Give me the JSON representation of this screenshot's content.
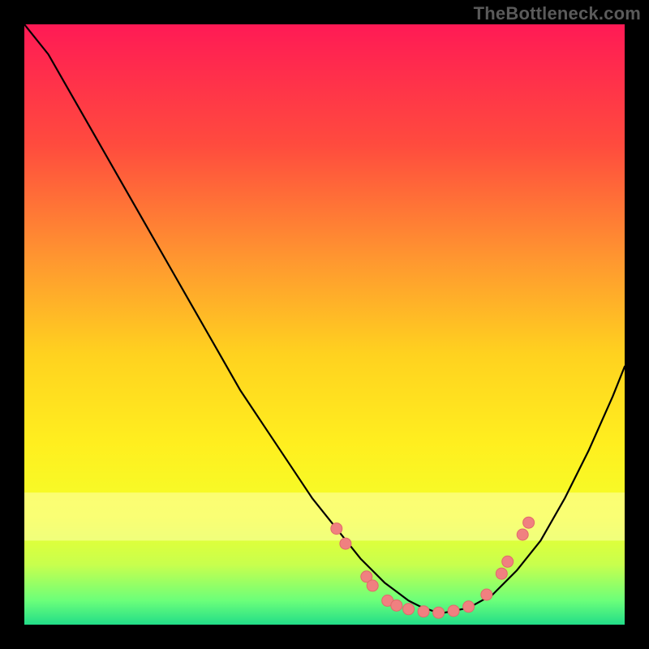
{
  "watermark": "TheBottleneck.com",
  "chart_data": {
    "type": "line",
    "title": "",
    "xlabel": "",
    "ylabel": "",
    "xlim": [
      0,
      100
    ],
    "ylim": [
      0,
      100
    ],
    "grid": false,
    "legend": false,
    "background_gradient": {
      "stops": [
        {
          "offset": 0.0,
          "color": "#ff1a55"
        },
        {
          "offset": 0.2,
          "color": "#ff4b3e"
        },
        {
          "offset": 0.4,
          "color": "#ff9a2f"
        },
        {
          "offset": 0.55,
          "color": "#ffd21f"
        },
        {
          "offset": 0.7,
          "color": "#ffef1f"
        },
        {
          "offset": 0.82,
          "color": "#f3ff2a"
        },
        {
          "offset": 0.9,
          "color": "#c8ff4d"
        },
        {
          "offset": 0.96,
          "color": "#6bff7a"
        },
        {
          "offset": 1.0,
          "color": "#22dd88"
        }
      ]
    },
    "pale_band": {
      "color": "#ffffb0",
      "opacity": 0.55,
      "y_top_frac": 0.78,
      "y_bottom_frac": 0.86
    },
    "series": [
      {
        "name": "bottleneck-curve",
        "stroke": "#000000",
        "stroke_width": 2.2,
        "x": [
          0,
          4,
          8,
          12,
          16,
          20,
          24,
          28,
          32,
          36,
          40,
          44,
          48,
          52,
          56,
          58,
          60,
          62,
          64,
          66,
          68,
          70,
          74,
          78,
          82,
          86,
          90,
          94,
          98,
          100
        ],
        "y": [
          100,
          95,
          88,
          81,
          74,
          67,
          60,
          53,
          46,
          39,
          33,
          27,
          21,
          16,
          11,
          9,
          7,
          5.5,
          4,
          3,
          2.3,
          2,
          2.8,
          5,
          9,
          14,
          21,
          29,
          38,
          43
        ]
      }
    ],
    "markers": {
      "name": "highlight-dots",
      "fill": "#f08080",
      "stroke": "#e06a6a",
      "radius": 7,
      "points": [
        {
          "x": 52.0,
          "y": 16.0
        },
        {
          "x": 53.5,
          "y": 13.5
        },
        {
          "x": 57.0,
          "y": 8.0
        },
        {
          "x": 58.0,
          "y": 6.5
        },
        {
          "x": 60.5,
          "y": 4.0
        },
        {
          "x": 62.0,
          "y": 3.2
        },
        {
          "x": 64.0,
          "y": 2.6
        },
        {
          "x": 66.5,
          "y": 2.2
        },
        {
          "x": 69.0,
          "y": 2.0
        },
        {
          "x": 71.5,
          "y": 2.3
        },
        {
          "x": 74.0,
          "y": 3.0
        },
        {
          "x": 77.0,
          "y": 5.0
        },
        {
          "x": 79.5,
          "y": 8.5
        },
        {
          "x": 80.5,
          "y": 10.5
        },
        {
          "x": 83.0,
          "y": 15.0
        },
        {
          "x": 84.0,
          "y": 17.0
        }
      ]
    }
  }
}
